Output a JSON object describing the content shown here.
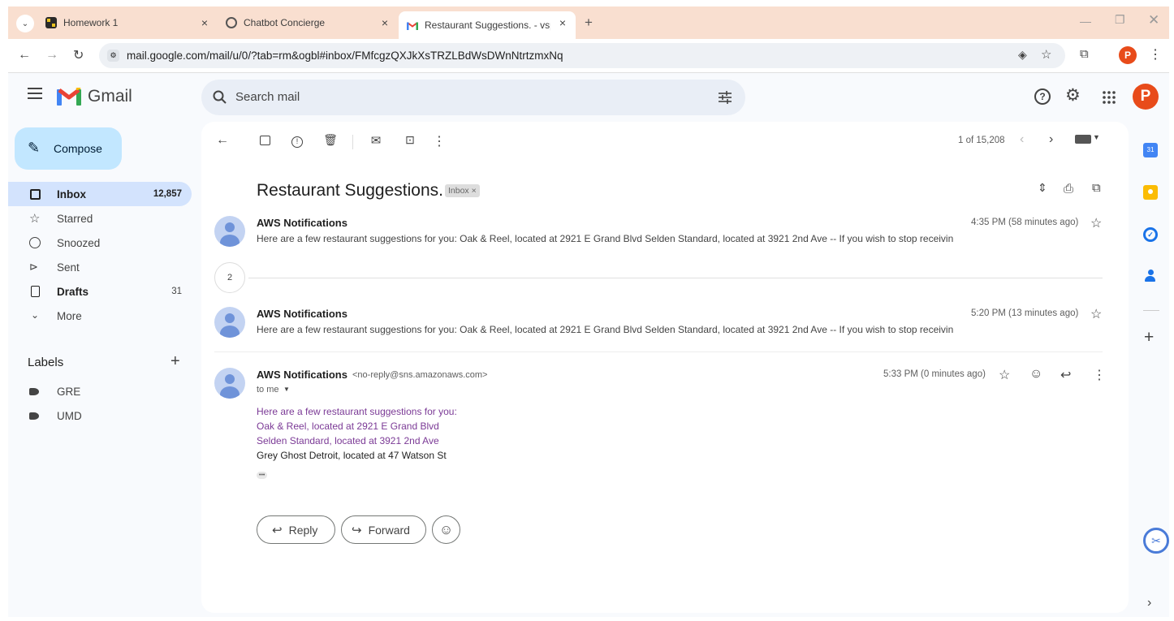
{
  "browser": {
    "tabs": [
      {
        "title": "Homework 1",
        "icon": "homework-favicon-icon",
        "close": "×"
      },
      {
        "title": "Chatbot Concierge",
        "icon": "globe-icon",
        "close": "×"
      },
      {
        "title": "Restaurant Suggestions. - vspra",
        "icon": "gmail-favicon-icon",
        "close": "×"
      }
    ],
    "new_tab": "+",
    "url": "mail.google.com/mail/u/0/?tab=rm&ogbl#inbox/FMfcgzQXJkXsTRZLBdWsDWnNtrtzmxNq",
    "profile_letter": "P"
  },
  "gmail": {
    "logo_text": "Gmail",
    "search_placeholder": "Search mail",
    "compose_label": "Compose",
    "nav": [
      {
        "label": "Inbox",
        "count": "12,857",
        "icon": "inbox-icon"
      },
      {
        "label": "Starred",
        "count": "",
        "icon": "star-icon"
      },
      {
        "label": "Snoozed",
        "count": "",
        "icon": "clock-icon"
      },
      {
        "label": "Sent",
        "count": "",
        "icon": "send-icon"
      },
      {
        "label": "Drafts",
        "count": "31",
        "icon": "draft-icon"
      },
      {
        "label": "More",
        "count": "",
        "icon": "chevron-down-icon"
      }
    ],
    "labels_header": "Labels",
    "labels": [
      "GRE",
      "UMD"
    ],
    "pager": "1 of 15,208",
    "thread": {
      "subject": "Restaurant Suggestions.",
      "tag": "Inbox ×",
      "collapsed_count": "2",
      "messages": [
        {
          "sender": "AWS Notifications",
          "time": "4:35 PM (58 minutes ago)",
          "snippet": "Here are a few restaurant suggestions for you: Oak & Reel, located at 2921 E Grand Blvd Selden Standard, located at 3921 2nd Ave -- If you wish to stop receivin"
        },
        {
          "sender": "AWS Notifications",
          "time": "5:20 PM (13 minutes ago)",
          "snippet": "Here are a few restaurant suggestions for you: Oak & Reel, located at 2921 E Grand Blvd Selden Standard, located at 3921 2nd Ave -- If you wish to stop receivin"
        }
      ],
      "open": {
        "sender": "AWS Notifications",
        "email": "<no-reply@sns.amazonaws.com>",
        "to": "to me",
        "time": "5:33 PM (0 minutes ago)",
        "body": [
          "Here are a few restaurant suggestions for you:",
          "Oak & Reel, located at 2921 E Grand Blvd",
          "Selden Standard, located at 3921 2nd Ave",
          "Grey Ghost Detroit, located at 47 Watson St"
        ],
        "ellipsis": "•••"
      },
      "reply_label": "Reply",
      "forward_label": "Forward"
    }
  },
  "colors": {
    "tabstrip": "#f9dfd0",
    "compose": "#c2e7ff",
    "selected_nav": "#d3e3fd",
    "link": "#7b3a96"
  }
}
